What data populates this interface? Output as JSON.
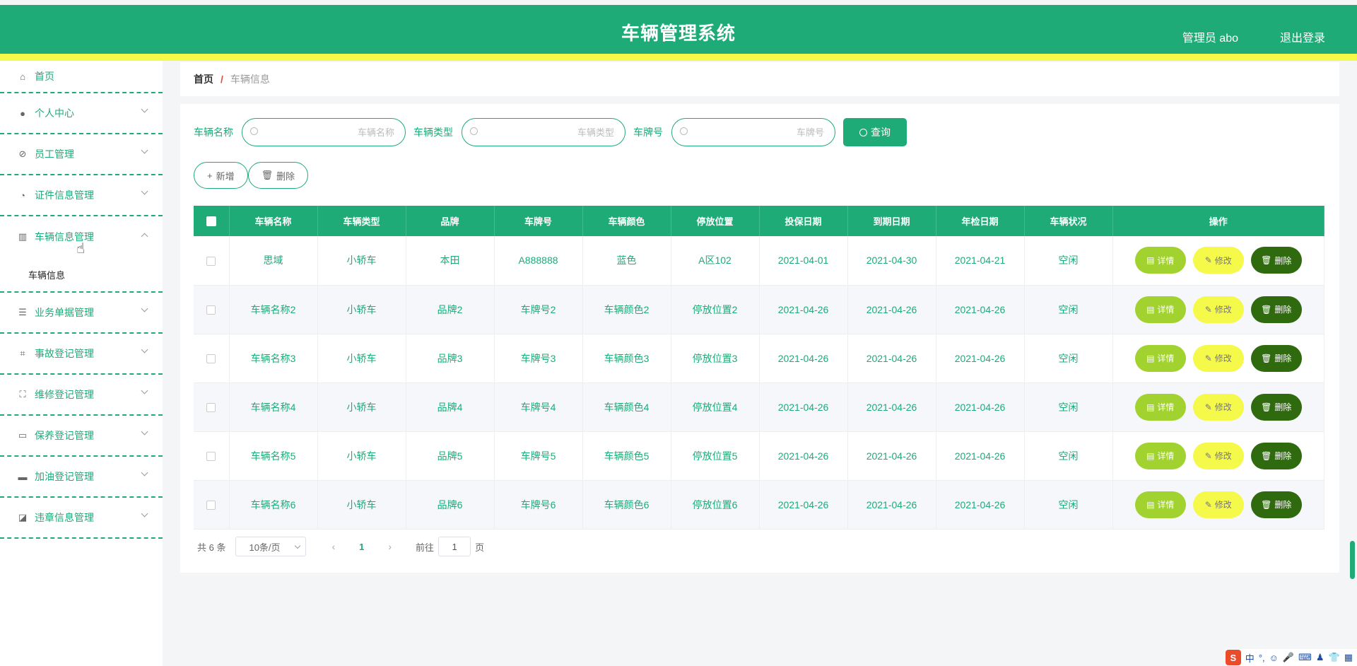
{
  "header": {
    "title": "车辆管理系统",
    "user": "管理员 abo",
    "logout": "退出登录"
  },
  "sidebar": {
    "items": [
      {
        "label": "首页",
        "icon": "home-icon",
        "glyph": "⌂"
      },
      {
        "label": "个人中心",
        "icon": "user-icon",
        "glyph": "●"
      },
      {
        "label": "员工管理",
        "icon": "bell-off-icon",
        "glyph": "⊘"
      },
      {
        "label": "证件信息管理",
        "icon": "gauge-icon",
        "glyph": "◔"
      },
      {
        "label": "车辆信息管理",
        "icon": "building-icon",
        "glyph": "▥"
      },
      {
        "label": "业务单据管理",
        "icon": "list-icon",
        "glyph": "☰"
      },
      {
        "label": "事故登记管理",
        "icon": "crop-icon",
        "glyph": "⌗"
      },
      {
        "label": "维修登记管理",
        "icon": "fullscreen-icon",
        "glyph": "⛶"
      },
      {
        "label": "保养登记管理",
        "icon": "card-icon",
        "glyph": "▭"
      },
      {
        "label": "加油登记管理",
        "icon": "wallet-icon",
        "glyph": "▬"
      },
      {
        "label": "违章信息管理",
        "icon": "chart-icon",
        "glyph": "◪"
      }
    ],
    "sub_item": "车辆信息"
  },
  "breadcrumb": {
    "home": "首页",
    "sep": "/",
    "current": "车辆信息"
  },
  "search": {
    "name_label": "车辆名称",
    "name_placeholder": "车辆名称",
    "type_label": "车辆类型",
    "type_placeholder": "车辆类型",
    "plate_label": "车牌号",
    "plate_placeholder": "车牌号",
    "query": "查询"
  },
  "actions": {
    "add": "新增",
    "delete": "删除"
  },
  "table": {
    "headers": [
      "车辆名称",
      "车辆类型",
      "品牌",
      "车牌号",
      "车辆颜色",
      "停放位置",
      "投保日期",
      "到期日期",
      "年检日期",
      "车辆状况",
      "操作"
    ],
    "rows": [
      [
        "思域",
        "小轿车",
        "本田",
        "A888888",
        "蓝色",
        "A区102",
        "2021-04-01",
        "2021-04-30",
        "2021-04-21",
        "空闲"
      ],
      [
        "车辆名称2",
        "小轿车",
        "品牌2",
        "车牌号2",
        "车辆颜色2",
        "停放位置2",
        "2021-04-26",
        "2021-04-26",
        "2021-04-26",
        "空闲"
      ],
      [
        "车辆名称3",
        "小轿车",
        "品牌3",
        "车牌号3",
        "车辆颜色3",
        "停放位置3",
        "2021-04-26",
        "2021-04-26",
        "2021-04-26",
        "空闲"
      ],
      [
        "车辆名称4",
        "小轿车",
        "品牌4",
        "车牌号4",
        "车辆颜色4",
        "停放位置4",
        "2021-04-26",
        "2021-04-26",
        "2021-04-26",
        "空闲"
      ],
      [
        "车辆名称5",
        "小轿车",
        "品牌5",
        "车牌号5",
        "车辆颜色5",
        "停放位置5",
        "2021-04-26",
        "2021-04-26",
        "2021-04-26",
        "空闲"
      ],
      [
        "车辆名称6",
        "小轿车",
        "品牌6",
        "车牌号6",
        "车辆颜色6",
        "停放位置6",
        "2021-04-26",
        "2021-04-26",
        "2021-04-26",
        "空闲"
      ]
    ],
    "op_detail": "详情",
    "op_edit": "修改",
    "op_delete": "删除"
  },
  "pager": {
    "total": "共 6 条",
    "page_size": "10条/页",
    "current": "1",
    "goto": "前往",
    "goto_value": "1",
    "unit": "页"
  },
  "tray": {
    "lang": "中"
  },
  "colors": {
    "primary": "#1eab78",
    "accent": "#f5fa4a",
    "detail": "#a2d22f",
    "danger": "#2f6a0e"
  }
}
